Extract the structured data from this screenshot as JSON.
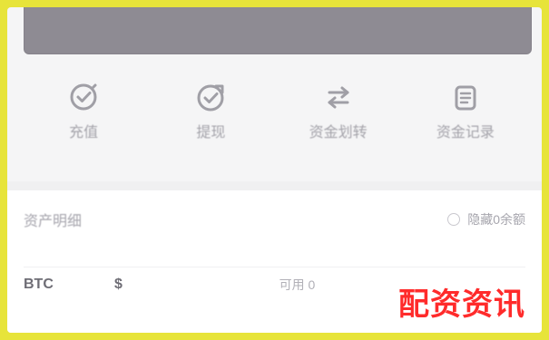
{
  "banner": {
    "text": ""
  },
  "actions": [
    {
      "label": "充值",
      "icon": "check-circle-icon"
    },
    {
      "label": "提现",
      "icon": "send-check-icon"
    },
    {
      "label": "资金划转",
      "icon": "transfer-icon"
    },
    {
      "label": "资金记录",
      "icon": "record-icon"
    }
  ],
  "assets": {
    "title": "资产明细",
    "toggle_label": "隐藏0余额",
    "rows": [
      {
        "symbol": "BTC",
        "value": "$",
        "middle": "可用 0"
      }
    ]
  },
  "watermark": {
    "text": "配资资讯"
  },
  "colors": {
    "frame_border": "#e7e43a",
    "banner_bg": "#8e8b93",
    "watermark": "#ff2b2b"
  }
}
